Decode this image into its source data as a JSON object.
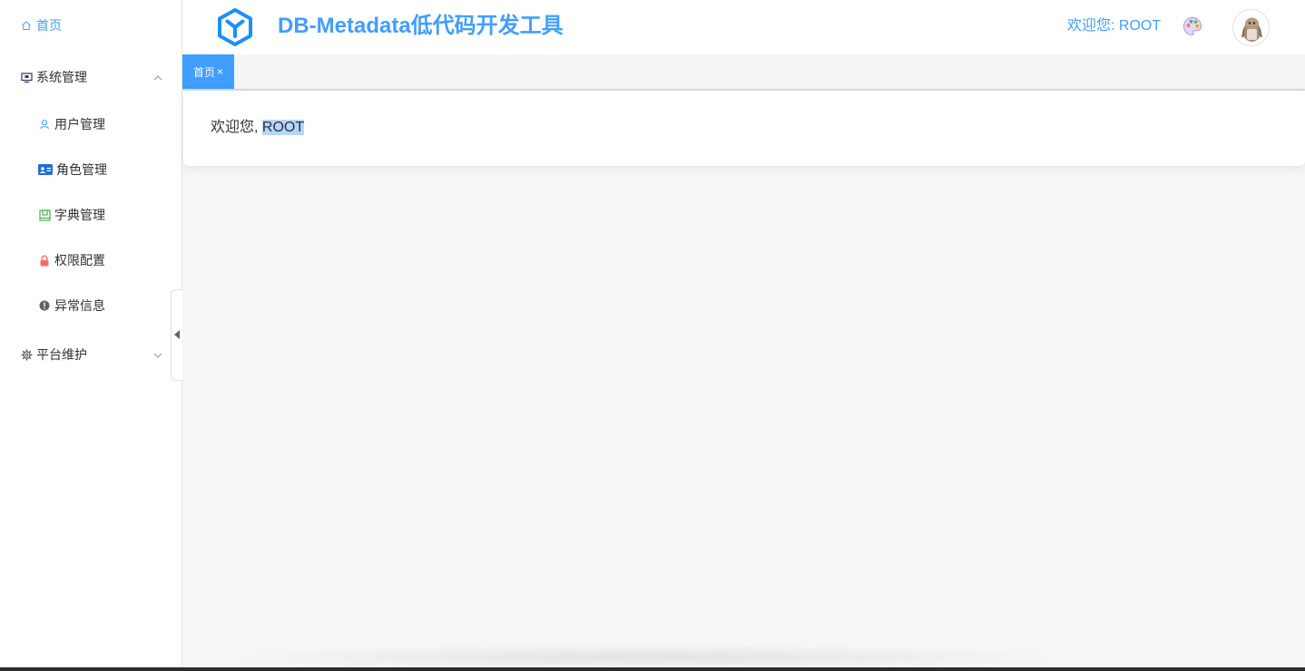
{
  "header": {
    "title": "DB-Metadata低代码开发工具",
    "welcome": "欢迎您: ROOT",
    "logo_icon": "cube-logo-icon",
    "theme_icon": "palette-icon",
    "avatar_icon": "user-avatar"
  },
  "sidebar": {
    "items": [
      {
        "label": "首页",
        "icon": "home-icon",
        "active": true
      },
      {
        "label": "系统管理",
        "icon": "monitor-icon",
        "expanded": true
      },
      {
        "label": "用户管理",
        "icon": "user-icon"
      },
      {
        "label": "角色管理",
        "icon": "id-card-icon"
      },
      {
        "label": "字典管理",
        "icon": "book-icon"
      },
      {
        "label": "权限配置",
        "icon": "lock-icon"
      },
      {
        "label": "异常信息",
        "icon": "warning-icon"
      },
      {
        "label": "平台维护",
        "icon": "gear-icon",
        "expanded": false
      }
    ]
  },
  "tabs": [
    {
      "label": "首页",
      "close": "×"
    }
  ],
  "content": {
    "greeting": "欢迎您, ",
    "username": "ROOT"
  },
  "colors": {
    "accent": "#409eff",
    "background": "#f6f6f7",
    "selection": "#b4d5fe"
  }
}
